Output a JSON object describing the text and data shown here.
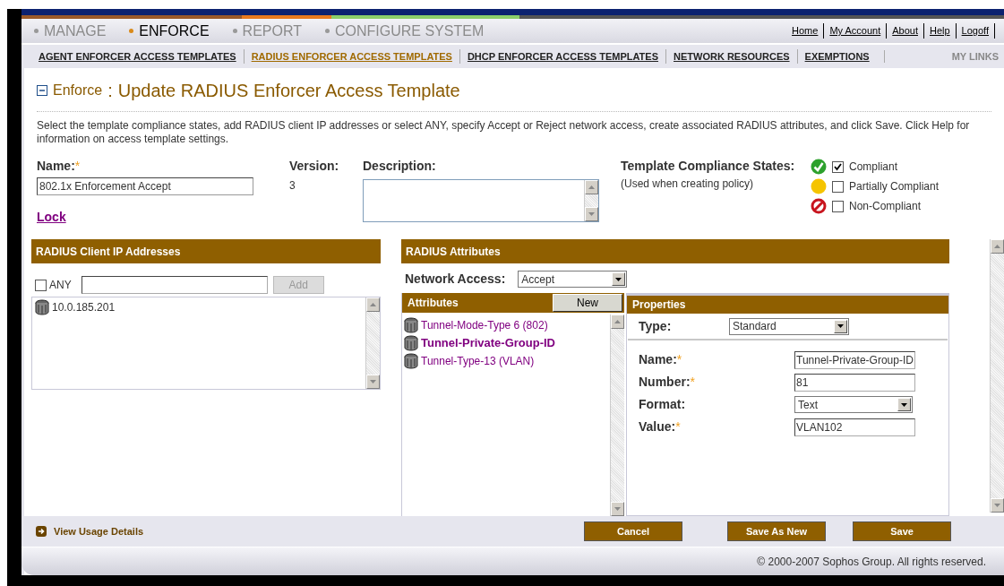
{
  "main_nav": [
    {
      "label": "MANAGE",
      "selected": false
    },
    {
      "label": "ENFORCE",
      "selected": true
    },
    {
      "label": "REPORT",
      "selected": false
    },
    {
      "label": "CONFIGURE SYSTEM",
      "selected": false
    }
  ],
  "top_links": [
    "Home",
    "My Account",
    "About",
    "Help",
    "Logoff"
  ],
  "sub_nav": [
    {
      "label": "AGENT ENFORCER ACCESS TEMPLATES",
      "selected": false
    },
    {
      "label": "RADIUS ENFORCER ACCESS TEMPLATES",
      "selected": true
    },
    {
      "label": "DHCP ENFORCER ACCESS TEMPLATES",
      "selected": false
    },
    {
      "label": "NETWORK RESOURCES",
      "selected": false
    },
    {
      "label": "EXEMPTIONS",
      "selected": false
    }
  ],
  "my_links": "MY LINKS",
  "header": {
    "section": "Enforce",
    "separator": ":",
    "title": "Update RADIUS Enforcer Access Template"
  },
  "instructions": "Select the template compliance states, add RADIUS client IP addresses or select ANY, specify Accept or Reject network access, create associated RADIUS attributes, and click Save. Click Help for information on access template settings.",
  "form": {
    "name_label": "Name:",
    "name_required_mark": "*",
    "name_value": "802.1x Enforcement Accept",
    "version_label": "Version:",
    "version": "3",
    "description_label": "Description:",
    "lock_link": "Lock"
  },
  "compliance": {
    "label": "Template Compliance States:",
    "note": "(Used when creating policy)",
    "states": [
      {
        "kind": "compliant",
        "label": "Compliant",
        "checked": true
      },
      {
        "kind": "partial",
        "label": "Partially Compliant",
        "checked": false
      },
      {
        "kind": "noncompliant",
        "label": "Non-Compliant",
        "checked": false
      }
    ]
  },
  "client_ips": {
    "title": "RADIUS Client IP Addresses",
    "any_label": "ANY",
    "any_checked": false,
    "add_button": "Add",
    "add_disabled": true,
    "items": [
      "10.0.185.201"
    ]
  },
  "attributes": {
    "title": "RADIUS Attributes",
    "network_access_label": "Network Access:",
    "network_access": "Accept",
    "list_title": "Attributes",
    "new_button": "New",
    "items": [
      {
        "label": "Tunnel-Mode-Type 6 (802)",
        "selected": false
      },
      {
        "label": "Tunnel-Private-Group-ID",
        "selected": true
      },
      {
        "label": "Tunnel-Type-13 (VLAN)",
        "selected": false
      }
    ]
  },
  "properties": {
    "title": "Properties",
    "type_label": "Type:",
    "type": "Standard",
    "fields": [
      {
        "kind": "text",
        "label": "Name:",
        "required_mark": "*",
        "value": "Tunnel-Private-Group-ID"
      },
      {
        "kind": "text",
        "label": "Number:",
        "required_mark": "*",
        "value": "81"
      },
      {
        "kind": "select",
        "label": "Format:",
        "value": "Text"
      },
      {
        "kind": "text",
        "label": "Value:",
        "required_mark": "*",
        "value": "VLAN102"
      }
    ]
  },
  "footer": {
    "usage_link": "View Usage Details",
    "buttons": [
      "Cancel",
      "Save As New",
      "Save"
    ],
    "copyright": "© 2000-2007 Sophos Group. All rights reserved."
  }
}
